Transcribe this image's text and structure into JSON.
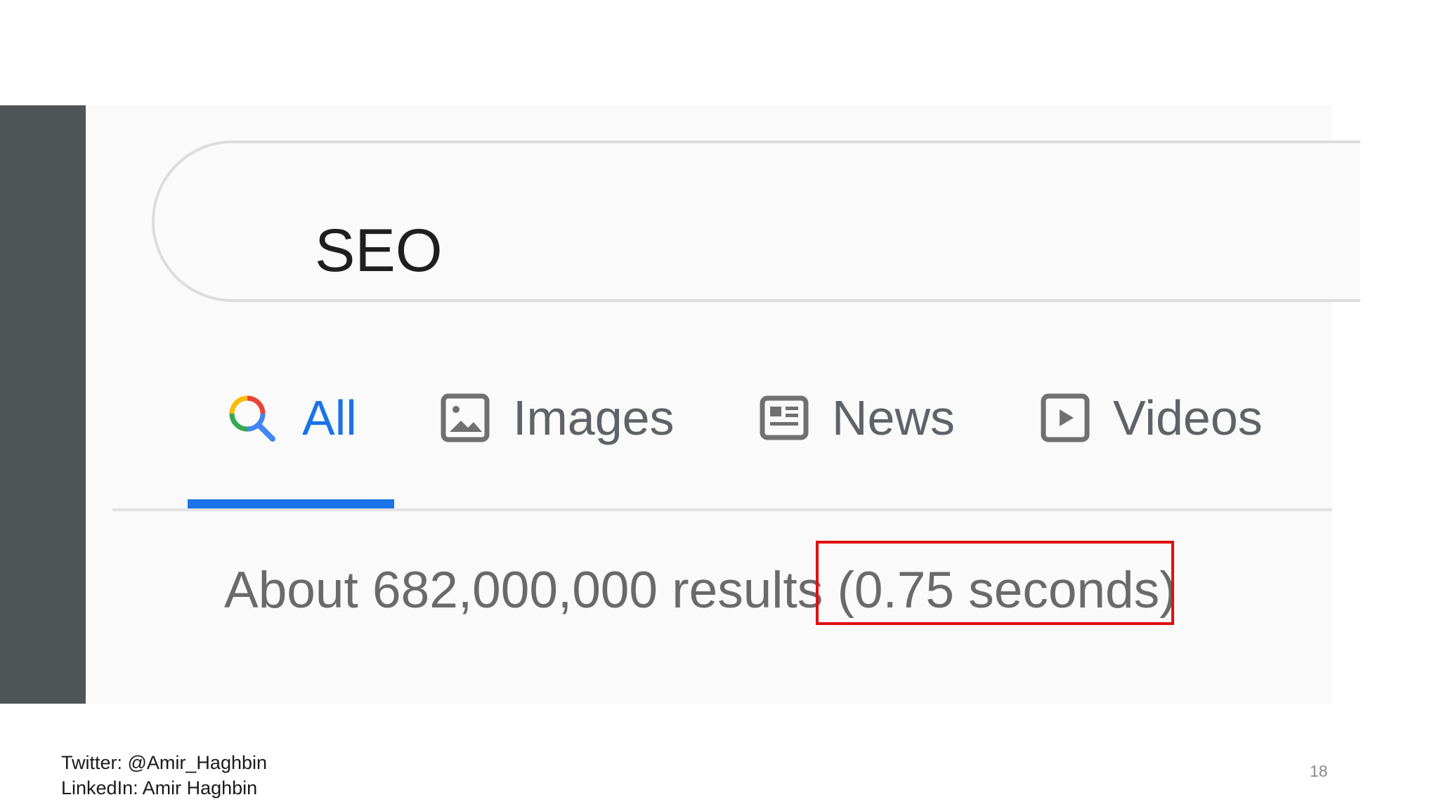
{
  "search": {
    "query": "SEO"
  },
  "tabs": [
    {
      "label": "All",
      "icon": "search-icon",
      "active": true
    },
    {
      "label": "Images",
      "icon": "image-icon",
      "active": false
    },
    {
      "label": "News",
      "icon": "newspaper-icon",
      "active": false
    },
    {
      "label": "Videos",
      "icon": "play-icon",
      "active": false
    }
  ],
  "results": {
    "count_text": "About 682,000,000 results",
    "time_text": "(0.75 seconds)"
  },
  "footer": {
    "twitter": "Twitter: @Amir_Haghbin",
    "linkedin": "LinkedIn: Amir Haghbin",
    "page_number": "18"
  },
  "colors": {
    "accent": "#1a73e8",
    "highlight": "#e01010",
    "sidebar": "#4f5556"
  }
}
